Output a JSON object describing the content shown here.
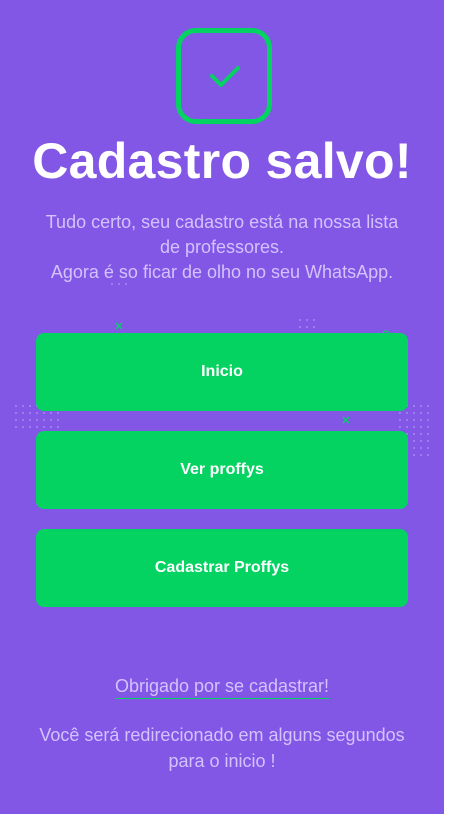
{
  "success": {
    "icon": "check-icon",
    "title": "Cadastro salvo!",
    "description_lines": [
      "Tudo certo, seu cadastro está na nossa lista",
      "de professores.",
      "Agora é so ficar de olho no seu WhatsApp."
    ]
  },
  "buttons": {
    "home": "Inicio",
    "view": "Ver proffys",
    "register": "Cadastrar Proffys"
  },
  "footer": {
    "thanks_link": "Obrigado por se cadastrar!",
    "redirect_lines": [
      "Você será redirecionado em alguns segundos",
      "para o inicio !"
    ]
  },
  "colors": {
    "background": "#8257e5",
    "accent_green": "#04d361",
    "text_light": "#d4c2ff",
    "white": "#ffffff"
  }
}
